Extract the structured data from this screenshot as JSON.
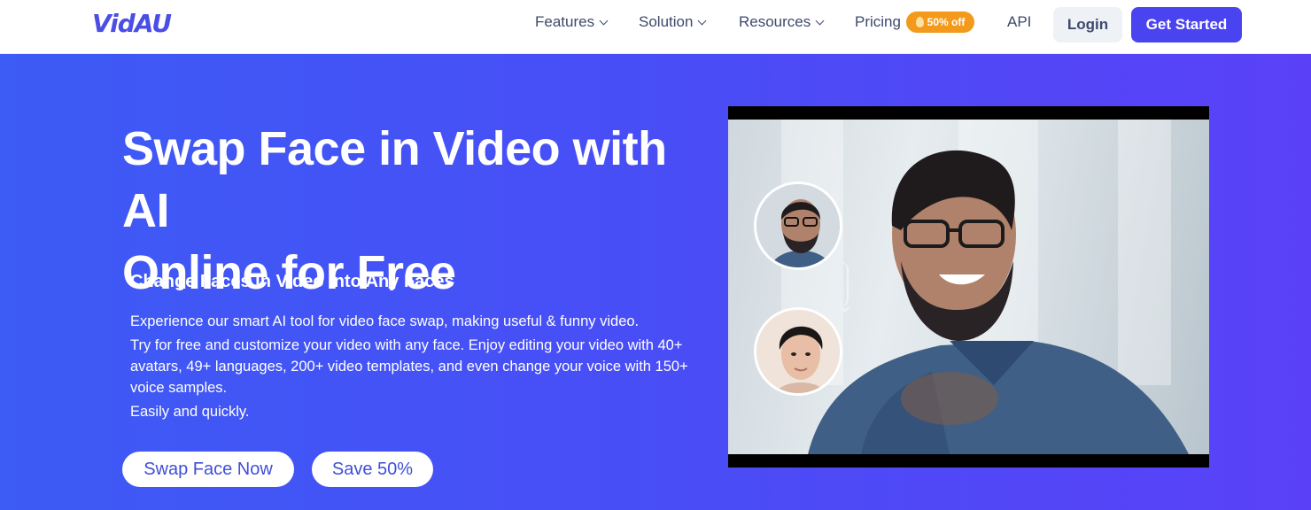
{
  "nav": {
    "logo": "VidAU",
    "features": "Features",
    "solution": "Solution",
    "resources": "Resources",
    "pricing": "Pricing",
    "pricing_badge": "50% off",
    "api": "API",
    "login": "Login",
    "get_started": "Get Started"
  },
  "hero": {
    "title_line1": "Swap Face in Video with AI",
    "title_line2": "Online for Free",
    "subtitle": "Change Faces in Video Into Any Faces",
    "desc_line1": "Experience our smart AI tool for video face swap, making useful & funny video.",
    "desc_line2": "Try for free and customize your video with any face. Enjoy editing your video with 40+ avatars, 49+ languages, 200+ video templates, and even change your voice with 150+ voice samples.",
    "desc_line3": "Easily and quickly.",
    "cta_primary": "Swap Face Now",
    "cta_secondary": "Save 50%"
  },
  "colors": {
    "brand": "#4a43f0",
    "badge": "#f39a1b",
    "hero_gradient_start": "#3d5bf5",
    "hero_gradient_end": "#5a41f8"
  }
}
